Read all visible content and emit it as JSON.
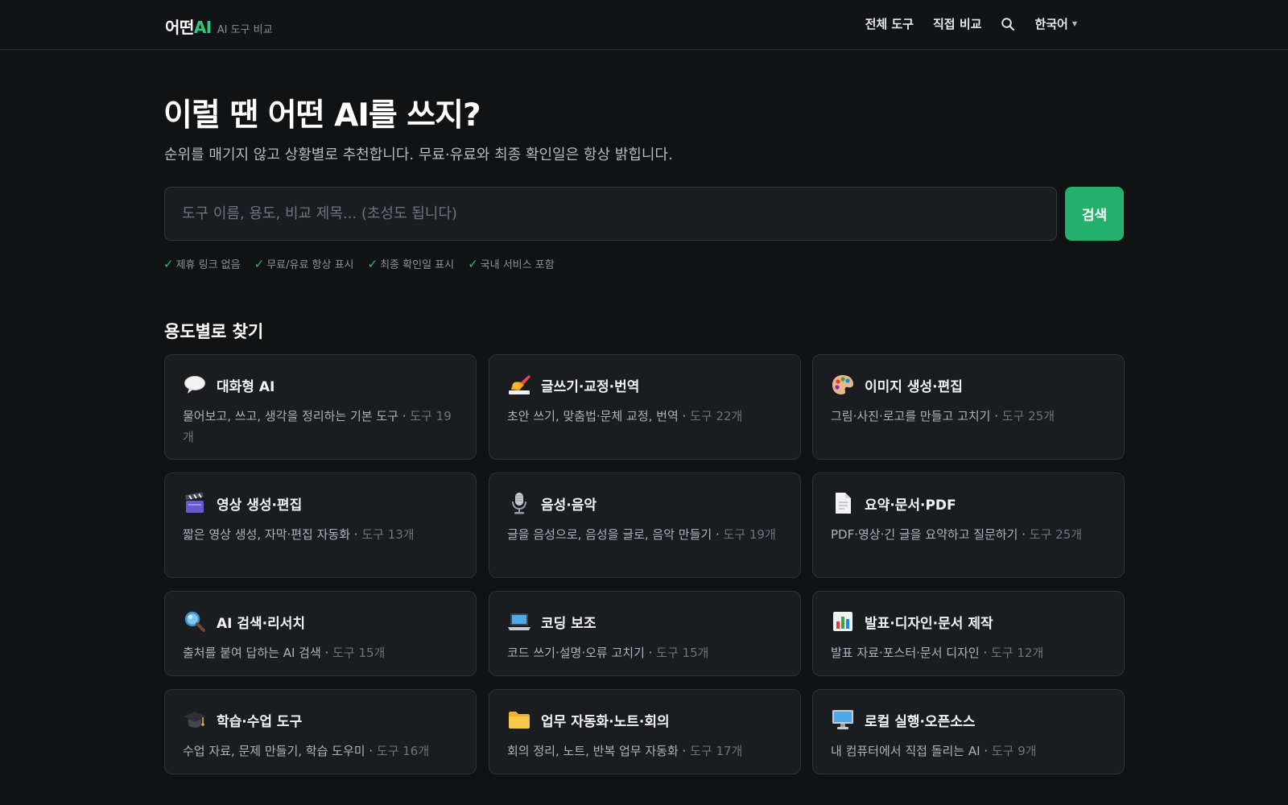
{
  "header": {
    "logo_main": "어떤",
    "logo_accent": "AI",
    "logo_sub": "AI 도구 비교",
    "nav": {
      "all_tools": "전체 도구",
      "compare": "직접 비교",
      "search_icon": "search-icon",
      "language": "한국어"
    }
  },
  "hero": {
    "title": "이럴 땐 어떤 AI를 쓰지?",
    "subtitle": "순위를 매기지 않고 상황별로 추천합니다. 무료·유료와 최종 확인일은 항상 밝힙니다.",
    "search_placeholder": "도구 이름, 용도, 비교 제목... (초성도 됩니다)",
    "search_value": "",
    "search_button": "검색",
    "badges": [
      "제휴 링크 없음",
      "무료/유료 항상 표시",
      "최종 확인일 표시",
      "국내 서비스 포함"
    ]
  },
  "categories": {
    "title": "용도별로 찾기",
    "items": [
      {
        "icon": "speech-bubble-icon",
        "title": "대화형 AI",
        "desc": "물어보고, 쓰고, 생각을 정리하는 기본 도구",
        "count": "도구 19개"
      },
      {
        "icon": "writing-hand-icon",
        "title": "글쓰기·교정·번역",
        "desc": "초안 쓰기, 맞춤법·문체 교정, 번역",
        "count": "도구 22개"
      },
      {
        "icon": "palette-icon",
        "title": "이미지 생성·편집",
        "desc": "그림·사진·로고를 만들고 고치기",
        "count": "도구 25개"
      },
      {
        "icon": "clapperboard-icon",
        "title": "영상 생성·편집",
        "desc": "짧은 영상 생성, 자막·편집 자동화",
        "count": "도구 13개"
      },
      {
        "icon": "microphone-icon",
        "title": "음성·음악",
        "desc": "글을 음성으로, 음성을 글로, 음악 만들기",
        "count": "도구 19개"
      },
      {
        "icon": "document-icon",
        "title": "요약·문서·PDF",
        "desc": "PDF·영상·긴 글을 요약하고 질문하기",
        "count": "도구 25개"
      },
      {
        "icon": "magnifier-icon",
        "title": "AI 검색·리서치",
        "desc": "출처를 붙여 답하는 AI 검색",
        "count": "도구 15개"
      },
      {
        "icon": "laptop-icon",
        "title": "코딩 보조",
        "desc": "코드 쓰기·설명·오류 고치기",
        "count": "도구 15개"
      },
      {
        "icon": "bar-chart-icon",
        "title": "발표·디자인·문서 제작",
        "desc": "발표 자료·포스터·문서 디자인",
        "count": "도구 12개"
      },
      {
        "icon": "graduation-cap-icon",
        "title": "학습·수업 도구",
        "desc": "수업 자료, 문제 만들기, 학습 도우미",
        "count": "도구 16개"
      },
      {
        "icon": "folder-icon",
        "title": "업무 자동화·노트·회의",
        "desc": "회의 정리, 노트, 반복 업무 자동화",
        "count": "도구 17개"
      },
      {
        "icon": "desktop-computer-icon",
        "title": "로컬 실행·오픈소스",
        "desc": "내 컴퓨터에서 직접 돌리는 AI",
        "count": "도구 9개"
      }
    ]
  }
}
